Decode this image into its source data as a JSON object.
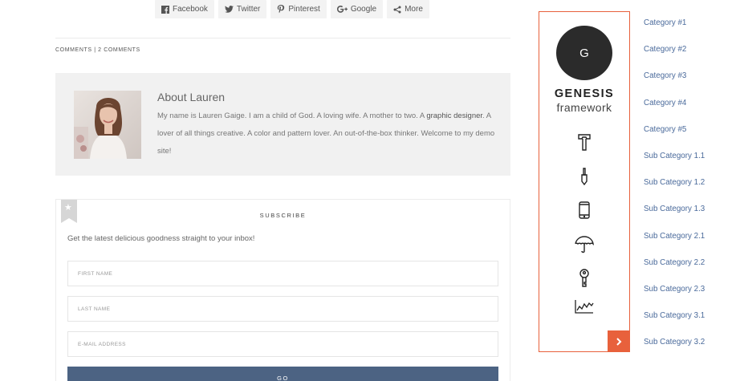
{
  "share": {
    "buttons": [
      {
        "label": "Facebook",
        "icon": "facebook-icon"
      },
      {
        "label": "Twitter",
        "icon": "twitter-icon"
      },
      {
        "label": "Pinterest",
        "icon": "pinterest-icon"
      },
      {
        "label": "Google",
        "icon": "google-plus-icon"
      },
      {
        "label": "More",
        "icon": "share-icon"
      }
    ]
  },
  "comments": {
    "label": "Comments",
    "separator": "|",
    "count_label": "2 Comments"
  },
  "about": {
    "title": "About Lauren",
    "text_before_link": "My name is Lauren Gaige. I am a child of God. A loving wife. A mother to two. A ",
    "link_text": "graphic designer",
    "text_after_link": ". A lover of all things creative. A color and pattern lover. An out-of-the-box thinker. Welcome to my demo site!"
  },
  "subscribe": {
    "title": "SUBSCRIBE",
    "text": "Get the latest delicious goodness straight to your inbox!",
    "first_name_placeholder": "FIRST NAME",
    "last_name_placeholder": "LAST NAME",
    "email_placeholder": "E-MAIL ADDRESS",
    "button_label": "GO"
  },
  "genesis": {
    "logo_letter": "G",
    "brand": "GENESIS",
    "tagline": "framework",
    "icons": [
      "hammer-icon",
      "chisel-icon",
      "mobile-icon",
      "umbrella-icon",
      "key-icon",
      "chart-icon"
    ]
  },
  "categories": [
    "Category #1",
    "Category #2",
    "Category #3",
    "Category #4",
    "Category #5",
    "Sub Category 1.1",
    "Sub Category 1.2",
    "Sub Category 1.3",
    "Sub Category 2.1",
    "Sub Category 2.2",
    "Sub Category 2.3",
    "Sub Category 3.1",
    "Sub Category 3.2"
  ],
  "colors": {
    "accent": "#e8613c",
    "button": "#4c6383",
    "link": "#4a6a9b",
    "panel_bg": "#f1f1f1"
  }
}
